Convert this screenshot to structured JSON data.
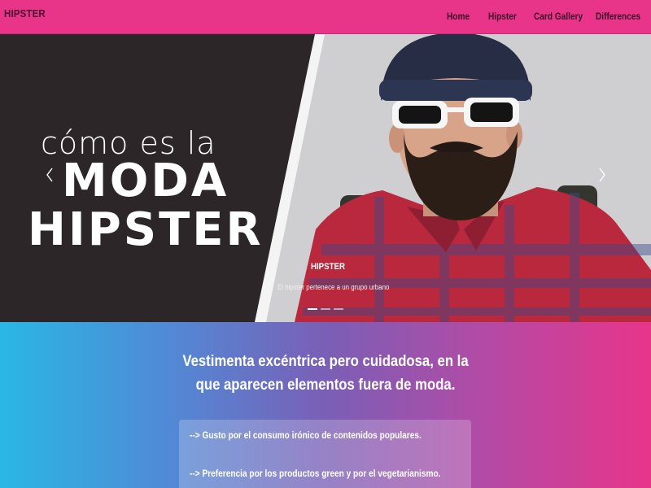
{
  "navbar": {
    "brand": "HIPSTER",
    "links": [
      "Home",
      "Hipster",
      "Card Gallery",
      "Differences"
    ],
    "color": "#e8358a"
  },
  "carousel": {
    "slide_image_text": [
      "cómo es la",
      "MODA",
      "HIPSTER"
    ],
    "caption_title": "HIPSTER",
    "caption_text": "El hipster pertenece a un grupo urbano",
    "indicator_count": 3,
    "active_indicator": 1
  },
  "content": {
    "headline_line1": "Vestimenta excéntrica pero cuidadosa, en la",
    "headline_line2": "que aparecen elementos fuera de moda.",
    "items": [
      "--> Gusto por el consumo irónico de contenidos populares.",
      "--> Preferencia por los productos green y por el vegetarianismo."
    ],
    "gradient": [
      "#2ab7e5",
      "#7a5fb6",
      "#e8358a"
    ]
  }
}
